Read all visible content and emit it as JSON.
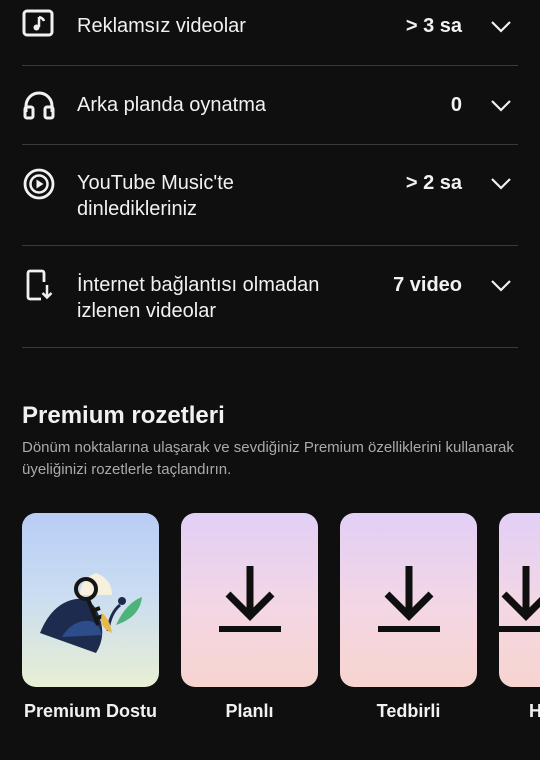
{
  "benefits": [
    {
      "icon": "music-note-icon",
      "label": "Reklamsız videolar",
      "value": "> 3 sa"
    },
    {
      "icon": "headphones-icon",
      "label": "Arka planda oynatma",
      "value": "0"
    },
    {
      "icon": "youtube-music-icon",
      "label": "YouTube Music'te dinledikleriniz",
      "value": "> 2 sa"
    },
    {
      "icon": "offline-download-icon",
      "label": "İnternet bağlantısı olmadan izlenen videolar",
      "value": "7 video"
    }
  ],
  "badges_section": {
    "title": "Premium rozetleri",
    "description": "Dönüm noktalarına ulaşarak ve sevdiğiniz Premium özelliklerini kullanarak üyeliğinizi rozetlerle taçlandırın.",
    "badges": [
      {
        "name": "Premium Dostu",
        "icon": "key-illustration-icon"
      },
      {
        "name": "Planlı",
        "icon": "download-icon"
      },
      {
        "name": "Tedbirli",
        "icon": "download-icon"
      },
      {
        "name": "H",
        "icon": "download-icon"
      }
    ]
  },
  "colors": {
    "background": "#0f0f0f",
    "divider": "#3a3a3a",
    "text": "#f1f1f1",
    "secondary_text": "#aaaaaa"
  }
}
